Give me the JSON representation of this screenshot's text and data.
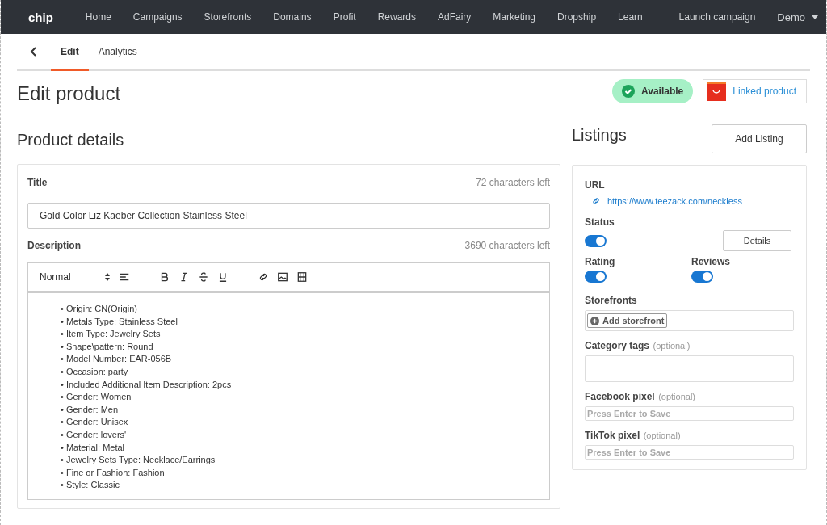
{
  "nav": {
    "logo": "chip",
    "items": [
      {
        "label": "Home"
      },
      {
        "label": "Campaigns"
      },
      {
        "label": "Storefronts"
      },
      {
        "label": "Domains"
      },
      {
        "label": "Profit"
      },
      {
        "label": "Rewards"
      },
      {
        "label": "AdFairy"
      },
      {
        "label": "Marketing"
      },
      {
        "label": "Dropship"
      },
      {
        "label": "Learn"
      }
    ],
    "cta": "Launch campaign",
    "account": "Demo"
  },
  "tabs": [
    {
      "label": "Edit",
      "selected": true
    },
    {
      "label": "Analytics",
      "selected": false
    }
  ],
  "page_title": "Edit product",
  "status_badge": "Available",
  "linked_button": "Linked product",
  "details": {
    "heading": "Product details",
    "title_label": "Title",
    "title_counter": "72 characters left",
    "title_value": "Gold Color Liz Kaeber Collection Stainless Steel",
    "description_label": "Description",
    "description_counter": "3690 characters left",
    "format": "Normal",
    "lines": [
      "• Origin: CN(Origin)",
      "• Metals Type: Stainless Steel",
      "• Item Type: Jewelry Sets",
      "• Shape\\pattern: Round",
      "• Model Number: EAR-056B",
      "• Occasion: party",
      "• Included Additional Item Description: 2pcs",
      "• Gender: Women",
      "• Gender: Men",
      "• Gender: Unisex",
      "• Gender: lovers'",
      "• Material: Metal",
      "• Jewelry Sets Type: Necklace/Earrings",
      "• Fine or Fashion: Fashion",
      "• Style: Classic"
    ]
  },
  "listings": {
    "heading": "Listings",
    "add_button": "Add Listing",
    "url_label": "URL",
    "url": "https://www.teezack.com/neckless",
    "status_label": "Status",
    "status_on": true,
    "details_button": "Details",
    "rating_label": "Rating",
    "rating_on": true,
    "reviews_label": "Reviews",
    "reviews_on": true,
    "storefronts_label": "Storefronts",
    "add_storefront": "Add storefront",
    "category_label": "Category tags",
    "category_hint": "(optional)",
    "facebook_label": "Facebook pixel",
    "facebook_hint": "(optional)",
    "facebook_placeholder": "Press Enter to Save",
    "tiktok_label": "TikTok pixel",
    "tiktok_hint": "(optional)",
    "tiktok_placeholder": "Press Enter to Save"
  }
}
